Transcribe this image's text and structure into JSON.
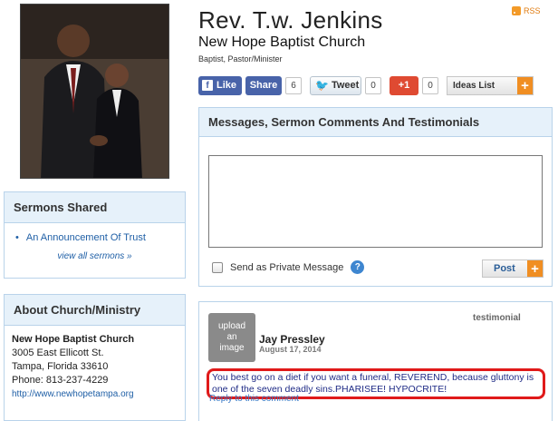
{
  "profile": {
    "name": "Rev. T.w. Jenkins",
    "church": "New Hope Baptist Church",
    "denomination": "Baptist, Pastor/Minister"
  },
  "rss": {
    "label": "RSS",
    "icon": "rss-icon"
  },
  "social": {
    "like_label": "Like",
    "share_label": "Share",
    "share_count": "6",
    "tweet_label": "Tweet",
    "tweet_count": "0",
    "gplus_label": "+1",
    "gplus_count": "0",
    "ideas_label": "Ideas List",
    "ideas_icon": "plus-icon"
  },
  "sermons": {
    "header": "Sermons Shared",
    "items": [
      {
        "label": "An Announcement Of Trust"
      }
    ],
    "view_all": "view all sermons »"
  },
  "about": {
    "header": "About Church/Ministry",
    "church_name": "New Hope Baptist Church",
    "address1": "3005 East Ellicott St.",
    "address2": "Tampa, Florida 33610",
    "phone": "Phone: 813-237-4229",
    "website": "http://www.newhopetampa.org"
  },
  "messages": {
    "header": "Messages, Sermon Comments And Testimonials",
    "textarea_value": "",
    "private_label": "Send as Private Message",
    "post_label": "Post"
  },
  "testimonial": {
    "avatar_placeholder": [
      "upload",
      "an",
      "image"
    ],
    "author": "Jay Pressley",
    "date": "August 17, 2014",
    "type": "testimonial",
    "text": "You best go on a diet if you want a funeral, REVEREND, because gluttony is one of the seven deadly sins.PHARISEE! HYPOCRITE!",
    "reply": "Reply to this comment"
  },
  "colors": {
    "link": "#1f5fa6",
    "facebook": "#4863a9",
    "gplus": "#df4a32",
    "accent_orange": "#f08e22",
    "panel_border": "#b9d3ea",
    "panel_header_bg": "#e6f1fa",
    "highlight_red": "#e01a1a"
  }
}
